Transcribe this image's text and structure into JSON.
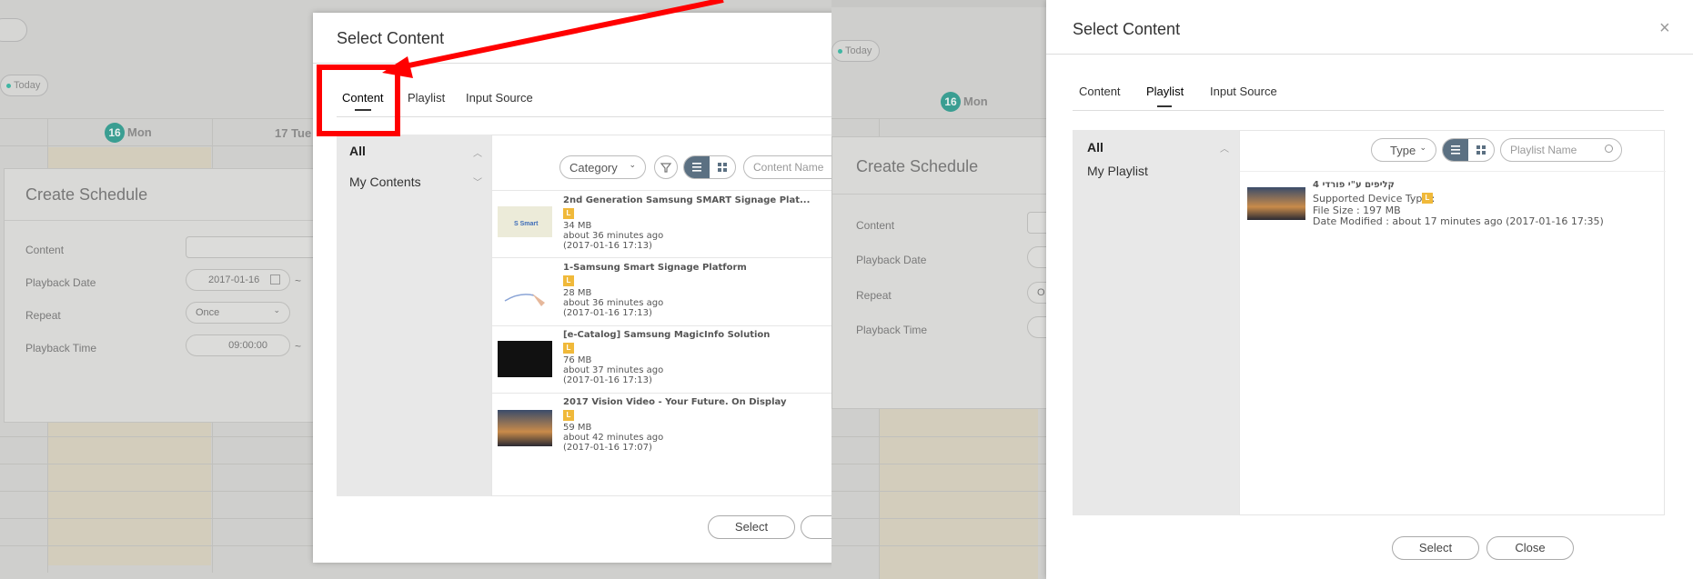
{
  "left": {
    "today_label": "Today",
    "day16_num": "16",
    "day16_label": "Mon",
    "day17": "17 Tue",
    "create_schedule": {
      "title": "Create Schedule",
      "labels": [
        "Content",
        "Playback Date",
        "Repeat",
        "Playback Time"
      ],
      "date_value": "2017-01-16",
      "repeat_value": "Once",
      "time_value": "09:00:00",
      "tilde": "~"
    },
    "modal": {
      "title": "Select Content",
      "tabs": [
        "Content",
        "Playlist",
        "Input Source"
      ],
      "sidebar": [
        "All",
        "My Contents"
      ],
      "category_label": "Category",
      "search_placeholder": "Content Name",
      "items": [
        {
          "title": "2nd Generation Samsung SMART Signage Plat...",
          "badge": "L",
          "size": "34 MB",
          "ago": "about 36 minutes ago",
          "date": "(2017-01-16 17:13)"
        },
        {
          "title": "1-Samsung Smart Signage Platform",
          "badge": "L",
          "size": "28 MB",
          "ago": "about 36 minutes ago",
          "date": "(2017-01-16 17:13)"
        },
        {
          "title": "[e-Catalog] Samsung MagicInfo Solution",
          "badge": "L",
          "size": "76 MB",
          "ago": "about 37 minutes ago",
          "date": "(2017-01-16 17:13)"
        },
        {
          "title": "2017 Vision Video - Your Future. On Display",
          "badge": "L",
          "size": "59 MB",
          "ago": "about 42 minutes ago",
          "date": "(2017-01-16 17:07)"
        }
      ],
      "select_label": "Select"
    }
  },
  "right": {
    "today_label": "Today",
    "day16_num": "16",
    "day16_label": "Mon",
    "create_schedule": {
      "title": "Create Schedule",
      "labels": [
        "Content",
        "Playback Date",
        "Repeat",
        "Playback Time"
      ],
      "repeat_partial": "O"
    },
    "modal": {
      "title": "Select Content",
      "close_icon": "×",
      "tabs": [
        "Content",
        "Playlist",
        "Input Source"
      ],
      "sidebar": [
        "All",
        "My Playlist"
      ],
      "type_label": "Type",
      "search_placeholder": "Playlist Name",
      "item": {
        "title": "קליפים ע\"י פורדי 4",
        "device_type": "Supported Device Type :",
        "badge": "L",
        "file_size": "File Size : 197 MB",
        "modified": "Date Modified : about 17 minutes ago (2017-01-16 17:35)"
      },
      "select_label": "Select",
      "close_label": "Close"
    }
  },
  "colors": {
    "annotation_red": "#ff0000",
    "accent_teal": "#3a9e92",
    "badge_orange": "#f0b93a"
  }
}
